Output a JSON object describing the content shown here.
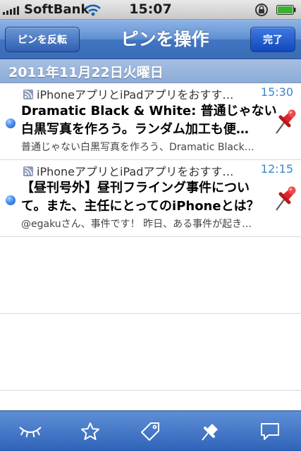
{
  "status_bar": {
    "carrier": "SoftBank",
    "time": "15:07"
  },
  "nav": {
    "left_button": "ピンを反転",
    "title": "ピンを操作",
    "right_button": "完了"
  },
  "date_header": "2011年11月22日火曜日",
  "items": [
    {
      "source": "iPhoneアプリとiPadアプリをおすす…",
      "time": "15:30",
      "title_line1": "Dramatic Black & White: 普通じゃない",
      "title_line2": "白黒写真を作ろう。ランダム加工も便…",
      "summary": "普通じゃない白黒写真を作ろう、Dramatic Black…",
      "unread": true,
      "pinned": true
    },
    {
      "source": "iPhoneアプリとiPadアプリをおすす…",
      "time": "12:15",
      "title_line1": "【昼刊号外】昼刊フライング事件につい",
      "title_line2": "て。また、主任にとってのiPhoneとは？",
      "summary": "@egakuさん、事件です！ 昨日、ある事件が起き…",
      "unread": true,
      "pinned": true
    }
  ],
  "tabs": [
    "eye-closed-icon",
    "star-icon",
    "tag-icon",
    "pin-icon",
    "comment-icon"
  ],
  "colors": {
    "accent": "#3a6bb6",
    "time": "#3a87c9",
    "unread": "#4b8ff0",
    "pin": "#e0262b"
  }
}
